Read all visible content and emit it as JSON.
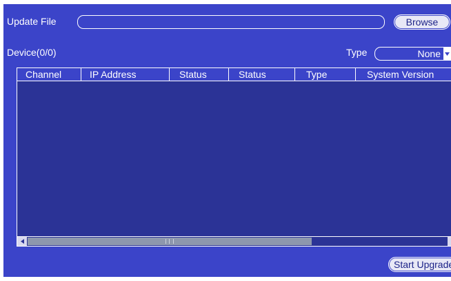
{
  "update_file": {
    "label": "Update File",
    "path_value": "",
    "browse_label": "Browse"
  },
  "device": {
    "count_label": "Device(0/0)",
    "type_label": "Type",
    "type_selected": "None"
  },
  "table": {
    "columns": [
      "Channel",
      "IP Address",
      "Status",
      "Status",
      "Type",
      "System Version"
    ],
    "rows": []
  },
  "actions": {
    "start_upgrade_label": "Start Upgrade"
  },
  "icons": {
    "dropdown": "chevron-down-icon",
    "scroll_left": "triangle-left-icon",
    "scroll_right": "triangle-right-icon"
  },
  "colors": {
    "panel_background": "#3b44c9",
    "table_body": "#2b3396",
    "text": "#ffffff",
    "button_text": "#1d2388"
  }
}
